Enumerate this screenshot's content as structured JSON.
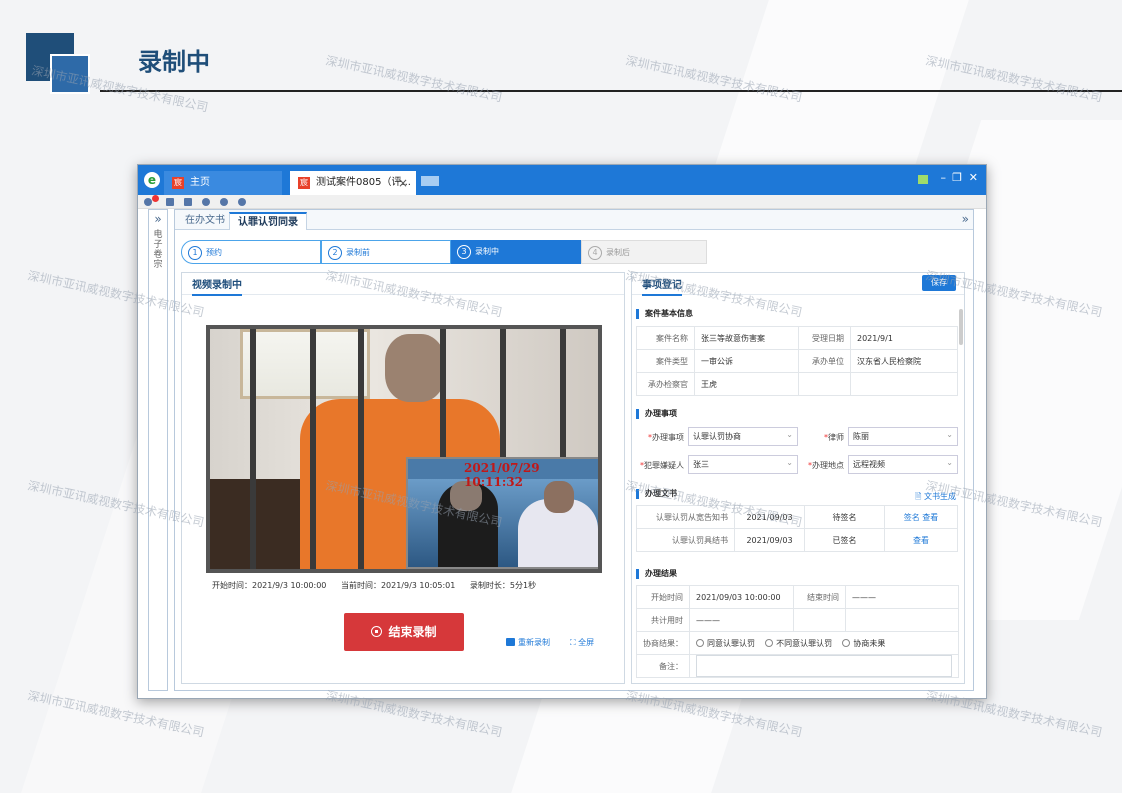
{
  "slide": {
    "title": "录制中"
  },
  "watermark": "深圳市亚讯威视数字技术有限公司",
  "window": {
    "tabs": [
      {
        "label": "主页"
      },
      {
        "label": "测试案件0805（评..."
      }
    ],
    "tab_close": "×",
    "side_label": "电子卷宗"
  },
  "content_tabs": {
    "tabs": [
      "在办文书",
      "认罪认罚同录"
    ]
  },
  "steps": [
    {
      "num": "1",
      "label": "预约"
    },
    {
      "num": "2",
      "label": "录制前"
    },
    {
      "num": "3",
      "label": "录制中"
    },
    {
      "num": "4",
      "label": "录制后"
    }
  ],
  "left": {
    "title": "视频录制中",
    "timestamp": "2021/07/29 10:11:32",
    "start_time": "开始时间：2021/9/3 10:00:00",
    "current_time": "当前时间：2021/9/3 10:05:01",
    "duration": "录制时长：5分1秒",
    "stop_label": "结束录制",
    "rerecord_label": "重新录制",
    "fullscreen_label": "全屏"
  },
  "right": {
    "title": "事项登记",
    "save_label": "保存",
    "case_section": "案件基本信息",
    "case": {
      "name_lbl": "案件名称",
      "name": "张三等故意伤害案",
      "date_lbl": "受理日期",
      "date": "2021/9/1",
      "type_lbl": "案件类型",
      "type": "一审公诉",
      "unit_lbl": "承办单位",
      "unit": "汉东省人民检察院",
      "prosecutor_lbl": "承办检察官",
      "prosecutor": "王虎"
    },
    "matters_section": "办理事项",
    "matters": {
      "item_lbl": "办理事项",
      "item": "认罪认罚协商",
      "lawyer_lbl": "律师",
      "lawyer": "陈丽",
      "suspect_lbl": "犯罪嫌疑人",
      "suspect": "张三",
      "place_lbl": "办理地点",
      "place": "远程视频"
    },
    "docs_section": "办理文书",
    "doc_gen_label": "文书生成",
    "docs": [
      {
        "name": "认罪认罚从宽告知书",
        "date": "2021/09/03",
        "status": "待签名",
        "actions": "签名  查看"
      },
      {
        "name": "认罪认罚具结书",
        "date": "2021/09/03",
        "status": "已签名",
        "actions": "查看"
      }
    ],
    "result_section": "办理结果",
    "result": {
      "start_lbl": "开始时间",
      "start": "2021/09/03 10:00:00",
      "end_lbl": "结束时间",
      "end": "———",
      "total_lbl": "共计用时",
      "total": "———",
      "outcome_lbl": "协商结果：",
      "options": [
        "同意认罪认罚",
        "不同意认罪认罚",
        "协商未果"
      ],
      "notes_lbl": "备注："
    }
  },
  "colors": {
    "brand": "#1e4d7b",
    "accent": "#1e78d7",
    "stop": "#d6383a"
  }
}
